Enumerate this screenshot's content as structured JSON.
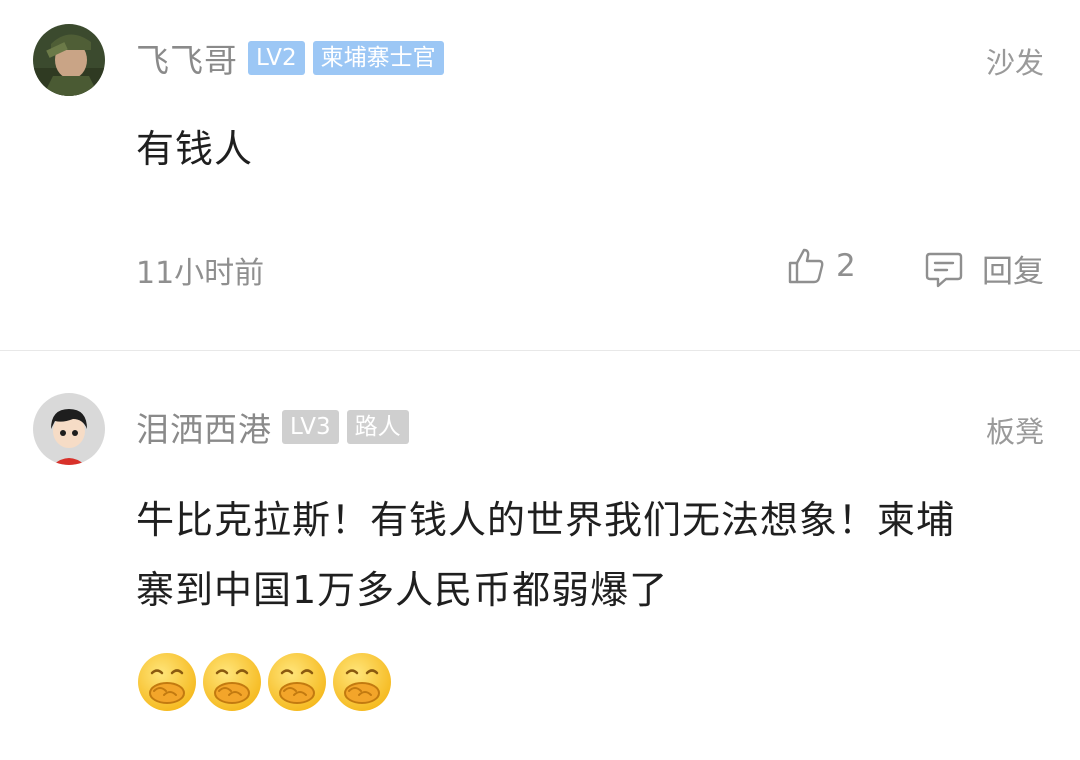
{
  "comments": [
    {
      "username": "飞飞哥",
      "level": "LV2",
      "title": "柬埔寨士官",
      "floor": "沙发",
      "text": "有钱人",
      "time": "11小时前",
      "likes": "2",
      "reply_label": "回复",
      "avatar_icon": "soldier-avatar"
    },
    {
      "username": "泪洒西港",
      "level": "LV3",
      "title": "路人",
      "floor": "板凳",
      "text": "牛比克拉斯！有钱人的世界我们无法想象！柬埔寨到中国1万多人民币都弱爆了",
      "emoji_icon": "covering-mouth-laugh-emoji",
      "emoji_count": 4,
      "avatar_icon": "cartoon-boy-avatar"
    }
  ],
  "colors": {
    "badge_blue": "#9cc7f5",
    "badge_gray": "#cfcfcf",
    "meta_text": "#8f8f8f"
  }
}
